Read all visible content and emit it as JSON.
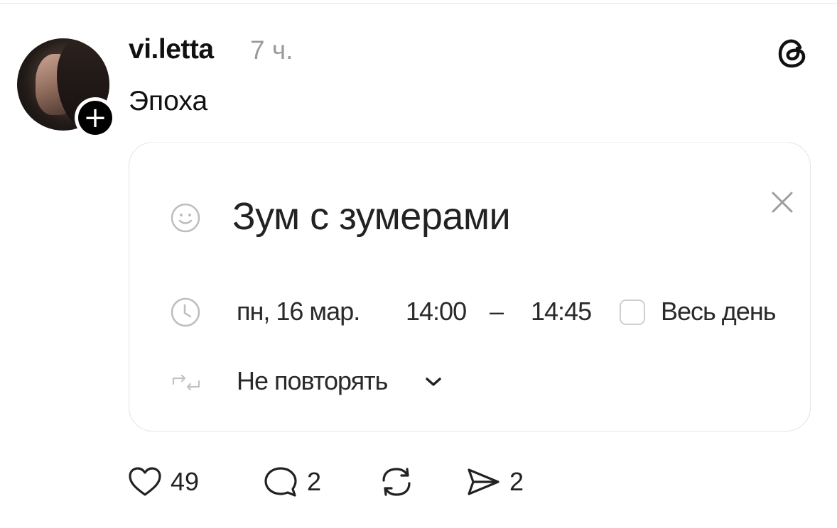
{
  "post": {
    "username": "vi.letta",
    "time": "7 ч.",
    "text": "Эпоха"
  },
  "card": {
    "title": "Зум с зумерами",
    "date": "пн, 16 мар.",
    "start_time": "14:00",
    "dash": "–",
    "end_time": "14:45",
    "all_day_label": "Весь день",
    "all_day_checked": false,
    "repeat_label": "Не повторять"
  },
  "actions": {
    "likes": "49",
    "replies": "2",
    "shares": "2"
  },
  "icons": [
    "plus-icon",
    "threads-logo-icon",
    "smile-icon",
    "close-icon",
    "clock-icon",
    "repeat-icon",
    "chevron-down-icon",
    "heart-icon",
    "comment-icon",
    "repost-icon",
    "send-icon"
  ]
}
